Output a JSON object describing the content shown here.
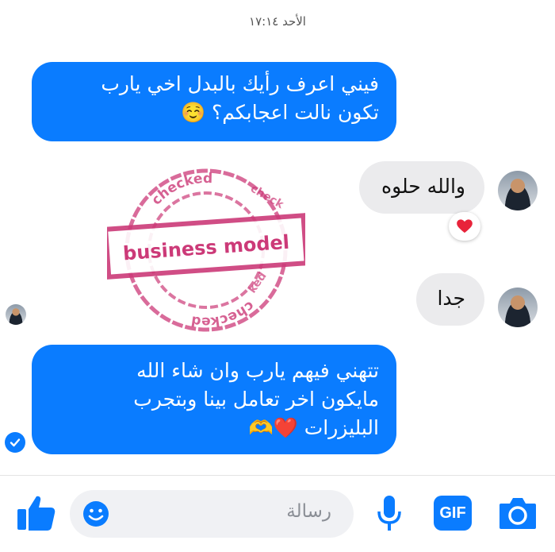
{
  "timestamp": "الأحد ١٧:١٤",
  "messages": {
    "m1": {
      "line1": "فيني اعرف رأيك بالبدل اخي يارب",
      "line2": "تكون نالت اعجابكم؟ ☺️"
    },
    "m2": {
      "text": "والله حلوه",
      "reaction": "heart"
    },
    "m3": {
      "text": "جدا"
    },
    "m4": {
      "line1": "تتهني فيهم يارب وان شاء الله",
      "line2": "مايكون اخر تعامل بينا وبتجرب",
      "line3": "البليزرات ❤️🫶"
    }
  },
  "stamp": {
    "main_text": "business model",
    "arc_top": "checked",
    "arc_right": "check",
    "arc_bottom": "checked",
    "arc_side": "ked",
    "color": "#cc3a78"
  },
  "composer": {
    "placeholder": "رسالة"
  },
  "icons": {
    "like": "thumbs-up-icon",
    "emoji": "emoji-icon",
    "mic": "microphone-icon",
    "gif": "GIF",
    "camera": "camera-icon"
  },
  "colors": {
    "accent": "#0a7cff",
    "incoming_bubble": "#ebebed",
    "heart": "#e8233a"
  }
}
